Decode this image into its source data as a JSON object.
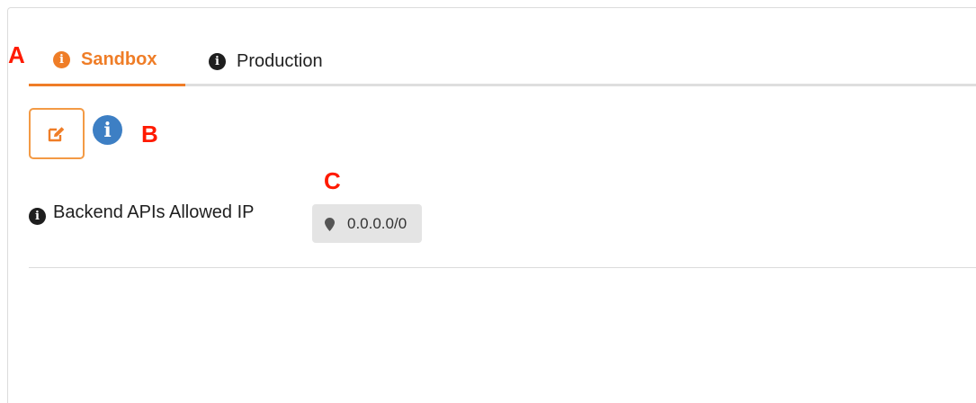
{
  "annotations": {
    "a": "A",
    "b": "B",
    "c": "C"
  },
  "tabs": [
    {
      "label": "Sandbox",
      "icon": "info-circle-icon",
      "active": true
    },
    {
      "label": "Production",
      "icon": "info-circle-icon",
      "active": false
    }
  ],
  "toolbar": {
    "edit_icon": "edit-pencil-icon",
    "info_icon": "info-circle-icon"
  },
  "field": {
    "label": "Backend APIs Allowed IP",
    "value": "0.0.0.0/0",
    "value_icon": "map-marker-icon"
  },
  "colors": {
    "accent": "#ef7d27",
    "info_blue": "#3d7fc4",
    "chip_bg": "#e4e4e4",
    "annotation": "#ff1a00"
  }
}
